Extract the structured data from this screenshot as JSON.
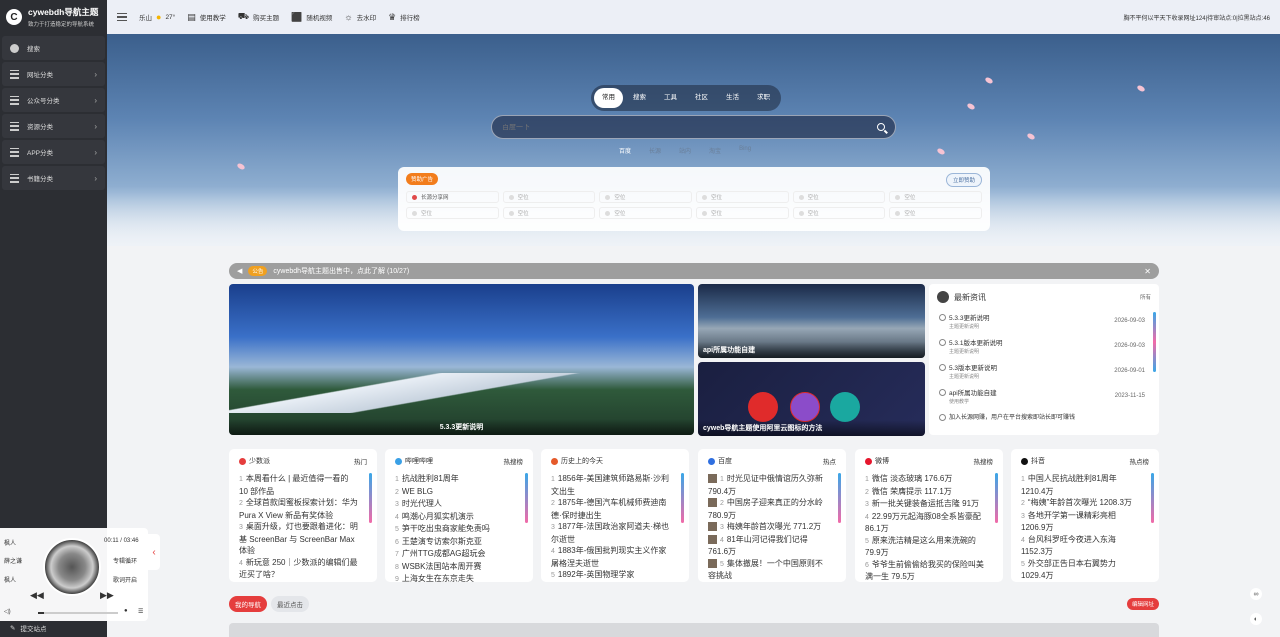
{
  "brand": {
    "name": "cywebdh导航主题",
    "slogan": "致力于打造稳定的导航系统",
    "logo_letter": "C"
  },
  "sidebar": {
    "items": [
      {
        "label": "搜索",
        "icon": "circle-icon"
      },
      {
        "label": "网址分类",
        "icon": "list-icon"
      },
      {
        "label": "公众号分类",
        "icon": "list-icon"
      },
      {
        "label": "资源分类",
        "icon": "list-icon"
      },
      {
        "label": "APP分类",
        "icon": "list-icon"
      },
      {
        "label": "书籍分类",
        "icon": "list-icon"
      }
    ],
    "submit": "提交站点"
  },
  "topbar": {
    "city": "乐山",
    "temp": "27°",
    "links": [
      "使用教学",
      "购买主题",
      "随机视频",
      "去水印",
      "排行榜"
    ],
    "stats": "胸不平何以平天下收录网址124|待审站点:0|拉黑站点:46"
  },
  "search": {
    "tabs": [
      "常用",
      "搜索",
      "工具",
      "社区",
      "生活",
      "求职"
    ],
    "active_tab": 0,
    "placeholder": "百度一下",
    "engines": [
      "百度",
      "长源",
      "站内",
      "淘宝",
      "Bing"
    ]
  },
  "ads": {
    "tag": "赞助广告",
    "button": "立即赞助",
    "first": "长源分享网",
    "placeholder": "空位"
  },
  "notice": {
    "tag": "公告",
    "text": "cywebdh导航主题出售中，点此了解 (10/27)"
  },
  "features": {
    "main_caption": "5.3.3更新说明",
    "lake_caption": "api所属功能自建",
    "icons_caption": "cyweb导航主题使用阿里云图标的方法"
  },
  "news": {
    "title": "最新资讯",
    "more": "所有",
    "items": [
      {
        "title": "5.3.3更新说明",
        "sub": "主题更新说明",
        "date": "2026-09-03"
      },
      {
        "title": "5.3.1版本更新说明",
        "sub": "主题更新说明",
        "date": "2026-09-03"
      },
      {
        "title": "5.3版本更新说明",
        "sub": "主题更新说明",
        "date": "2026-09-01"
      },
      {
        "title": "api所属功能自建",
        "sub": "使用教学",
        "date": "2023-11-15"
      },
      {
        "title": "加入长源网赚，用户在平台搜索即站长即可赚钱",
        "sub": "",
        "date": ""
      }
    ]
  },
  "hot": [
    {
      "name": "少数派",
      "tag": "热门",
      "color": "#e53d3d",
      "items": [
        {
          "n": "1",
          "t": "本周看什么 | 最近值得一看的 10 部作品"
        },
        {
          "n": "2",
          "t": "全球首款闺蜜板探索计划：华为 Pura X View 新品有奖体验"
        },
        {
          "n": "3",
          "t": "桌面升级，灯也要跟着进化：明基 ScreenBar 与 ScreenBar Max 体验"
        },
        {
          "n": "4",
          "t": "新玩意 250｜少数派的编辑们最近买了啥？"
        }
      ]
    },
    {
      "name": "哔哩哔哩",
      "tag": "热搜榜",
      "color": "#3aa0e6",
      "items": [
        {
          "n": "1",
          "t": "抗战胜利81周年"
        },
        {
          "n": "2",
          "t": "WE BLG"
        },
        {
          "n": "3",
          "t": "时光代理人"
        },
        {
          "n": "4",
          "t": "鸣潮心月狐实机演示"
        },
        {
          "n": "5",
          "t": "笋干吃出虫商家能免责吗"
        },
        {
          "n": "6",
          "t": "王楚演专访索尔斯克亚"
        },
        {
          "n": "7",
          "t": "广州TTG成都AG超玩会"
        },
        {
          "n": "8",
          "t": "WSBK法国站本周开赛"
        },
        {
          "n": "9",
          "t": "上海女生在东京走失"
        }
      ]
    },
    {
      "name": "历史上的今天",
      "tag": "",
      "color": "#e55a2a",
      "items": [
        {
          "n": "1",
          "t": "1856年-美国建筑师路易斯·沙利文出生"
        },
        {
          "n": "2",
          "t": "1875年-德国汽车机械师费迪南德·保时捷出生"
        },
        {
          "n": "3",
          "t": "1877年-法国政治家阿道夫·梯也尔逝世"
        },
        {
          "n": "4",
          "t": "1883年-俄国批判现实主义作家屠格涅夫逝世"
        },
        {
          "n": "5",
          "t": "1892年-英国物理学家"
        }
      ]
    },
    {
      "name": "百度",
      "tag": "热点",
      "color": "#2f6fe0",
      "items": [
        {
          "n": "1",
          "t": "时光见证中俄情谊历久弥新 790.4万"
        },
        {
          "n": "2",
          "t": "中国房子迎来真正的分水岭 780.9万"
        },
        {
          "n": "3",
          "t": "梅姨年龄首次曝光 771.2万"
        },
        {
          "n": "4",
          "t": "81年山河记得我们记得 761.6万"
        },
        {
          "n": "5",
          "t": "集体撤展！一个中国原则不容挑战"
        }
      ]
    },
    {
      "name": "微博",
      "tag": "热搜榜",
      "color": "#e6162d",
      "items": [
        {
          "n": "1",
          "t": "微信 淡态玻璃 176.6万"
        },
        {
          "n": "2",
          "t": "微信 荣膺提示 117.1万"
        },
        {
          "n": "3",
          "t": "新一批关键装备运抵吉隆 91万"
        },
        {
          "n": "4",
          "t": "22.99万元起海豚08全系皆豪配 86.1万"
        },
        {
          "n": "5",
          "t": "原来洗洁精是这么用来洗碗的 79.9万"
        },
        {
          "n": "6",
          "t": "爷爷生前偷偷给我买的保险叫美满一生 79.5万"
        }
      ]
    },
    {
      "name": "抖音",
      "tag": "热点榜",
      "color": "#111111",
      "items": [
        {
          "n": "1",
          "t": "中国人民抗战胜利81周年 1210.4万"
        },
        {
          "n": "2",
          "t": "“梅姨”年龄首次曝光 1208.3万"
        },
        {
          "n": "3",
          "t": "各地开学第一课精彩亮相 1206.9万"
        },
        {
          "n": "4",
          "t": "台风科罗旺今夜进入东海 1152.3万"
        },
        {
          "n": "5",
          "t": "外交部正告日本右翼势力 1029.4万"
        }
      ]
    }
  ],
  "nav": {
    "tabs": [
      "我的导航",
      "最近点击"
    ],
    "edit": "编辑网址"
  },
  "player": {
    "left1": "枫人",
    "left2": "薛之谦",
    "left3": "枫人",
    "time": "00:11 / 03:46",
    "mode": "专辑循环",
    "lyric": "歌词开启"
  }
}
